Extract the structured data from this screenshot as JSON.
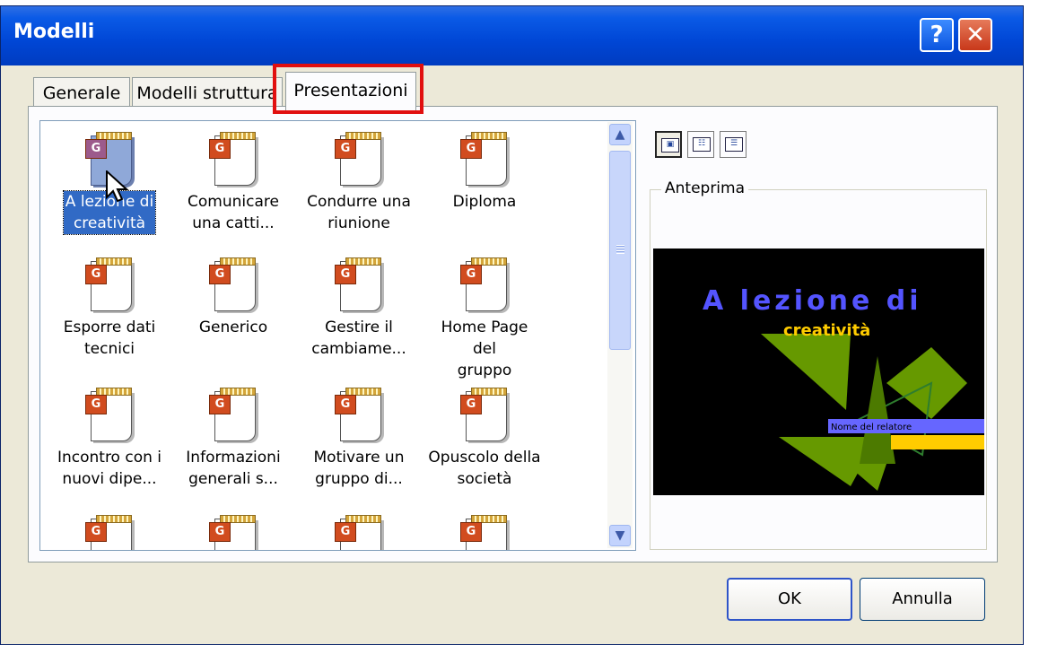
{
  "window": {
    "title": "Modelli"
  },
  "titlebar": {
    "help_glyph": "?",
    "close_glyph": "✕"
  },
  "tabs": [
    {
      "label": "Generale"
    },
    {
      "label": "Modelli struttura"
    },
    {
      "label": "Presentazioni"
    }
  ],
  "templates": [
    {
      "label": "A lezione di creatività",
      "line1": "A lezione di",
      "line2": "creatività",
      "selected": true
    },
    {
      "line1": "Comunicare",
      "line2": "una catti..."
    },
    {
      "line1": "Condurre una",
      "line2": "riunione"
    },
    {
      "line1": "Diploma",
      "line2": ""
    },
    {
      "line1": "Esporre dati",
      "line2": "tecnici"
    },
    {
      "line1": "Generico",
      "line2": ""
    },
    {
      "line1": "Gestire il",
      "line2": "cambiame..."
    },
    {
      "line1": "Home Page del",
      "line2": "gruppo"
    },
    {
      "line1": "Incontro con i",
      "line2": "nuovi dipe..."
    },
    {
      "line1": "Informazioni",
      "line2": "generali s..."
    },
    {
      "line1": "Motivare un",
      "line2": "gruppo di..."
    },
    {
      "line1": "Opuscolo della",
      "line2": "società"
    }
  ],
  "preview": {
    "label": "Anteprima",
    "slide_title": "A lezione di",
    "slide_subtitle": "creatività",
    "slide_name_bar": "Nome del relatore",
    "colors": {
      "title": "#5454ff",
      "subtitle": "#ffcc00",
      "shapes": "#669900",
      "bar_blue": "#6666ff",
      "bar_yellow": "#ffcc00"
    }
  },
  "buttons": {
    "ok": "OK",
    "cancel": "Annulla"
  },
  "accent_colors": {
    "highlight": "#e10f0f",
    "titlebar": "#0046d5",
    "selection": "#316ac5"
  }
}
